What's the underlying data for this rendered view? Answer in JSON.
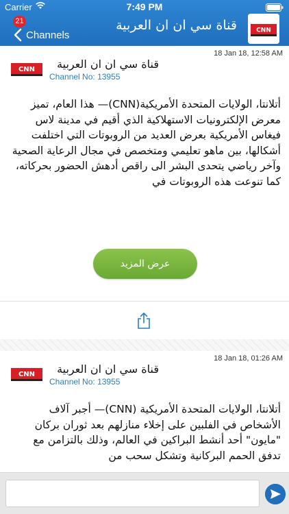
{
  "status_bar": {
    "carrier": "Carrier",
    "time": "7:49 PM"
  },
  "header": {
    "badge": "21",
    "back_label": "Channels",
    "title": "قناة سي ان ان العربية",
    "logo_icon": "cnn-arabic-logo"
  },
  "messages": [
    {
      "date": "18 Jan 18, 12:58 AM",
      "channel_name": "قناة سي ان ان العربية",
      "channel_no_label": "Channel No:",
      "channel_no": "13955",
      "body": "أتلانتا، الولايات المتحدة الأمريكية(CNN)— هذا العام، تميز معرض الإلكترونيات الاستهلاكية الذي أقيم في مدينة لاس فيغاس الأمريكية بعرض العديد من الروبوتات التي اختلفت أشكالها، بين ماهو تعليمي ومتخصص في مجال الرعاية الصحية وآخر رياضي يتحدى البشر الى راقص أدهش الحضور بحركاته، كما تنوعت هذه الروبوتات في",
      "more_label": "عرض المزيد"
    },
    {
      "date": "18 Jan 18, 01:26 AM",
      "channel_name": "قناة سي ان ان العربية",
      "channel_no_label": "Channel No:",
      "channel_no": "13955",
      "body": "أتلانتا، الولايات المتحدة الأمريكية (CNN)— أجبر آلاف الأشخاص في الفلبين على إخلاء منازلهم بعد ثوران بركان \"مايون\" أحد أنشط البراكين في العالم، وذلك بالتزامن مع تدفق الحمم البركانية وتشكل سحب من"
    }
  ],
  "input": {
    "value": "",
    "placeholder": ""
  },
  "colors": {
    "accent": "#1f6fbd",
    "button_green": "#7ab842",
    "badge_red": "#e3262d"
  }
}
